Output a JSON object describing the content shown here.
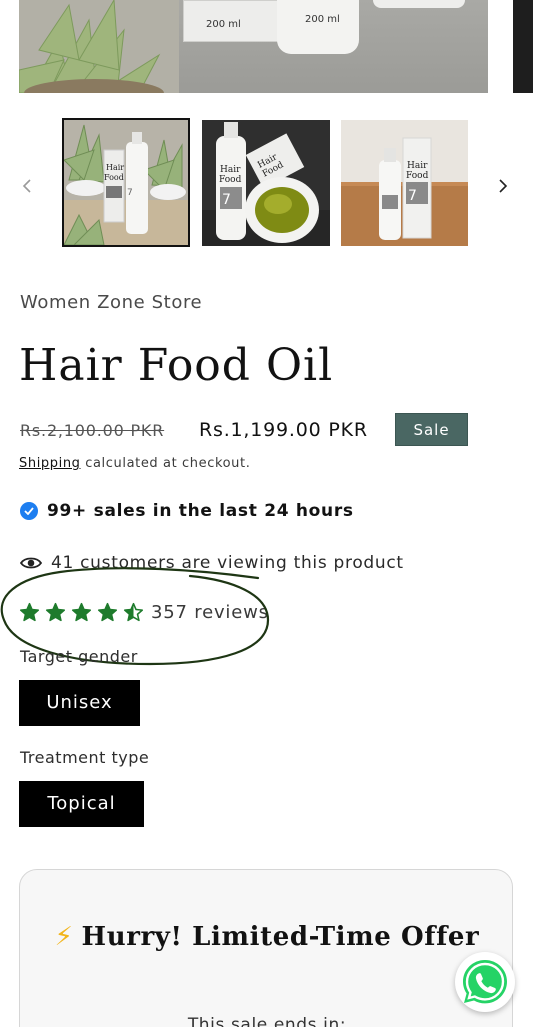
{
  "gallery": {
    "hero_labels": [
      "200 ml",
      "200 ml"
    ],
    "thumbnail_count": 3,
    "selected_thumbnail": 1
  },
  "product": {
    "vendor": "Women Zone Store",
    "title": "Hair Food Oil",
    "price_compare": "Rs.2,100.00 PKR",
    "price": "Rs.1,199.00 PKR",
    "sale_badge": "Sale",
    "shipping_link": "Shipping",
    "shipping_text": " calculated at checkout."
  },
  "social_proof": {
    "sales_text": "99+ sales in the last 24 hours",
    "viewers_text": "41 customers are viewing this product",
    "rating_stars": 4.5,
    "rating_max": 5,
    "reviews_text": "357 reviews"
  },
  "options": [
    {
      "label": "Target gender",
      "value": "Unisex"
    },
    {
      "label": "Treatment type",
      "value": "Topical"
    }
  ],
  "offer": {
    "icon": "⚡",
    "heading": "Hurry! Limited-Time Offer",
    "subtext": "This sale ends in:"
  },
  "colors": {
    "sale_badge": "#4a6763",
    "star": "#1e7b2c",
    "check": "#1d7ef0",
    "annotation": "#1e3614",
    "pill": "#000000",
    "whatsapp": "#25d366"
  }
}
